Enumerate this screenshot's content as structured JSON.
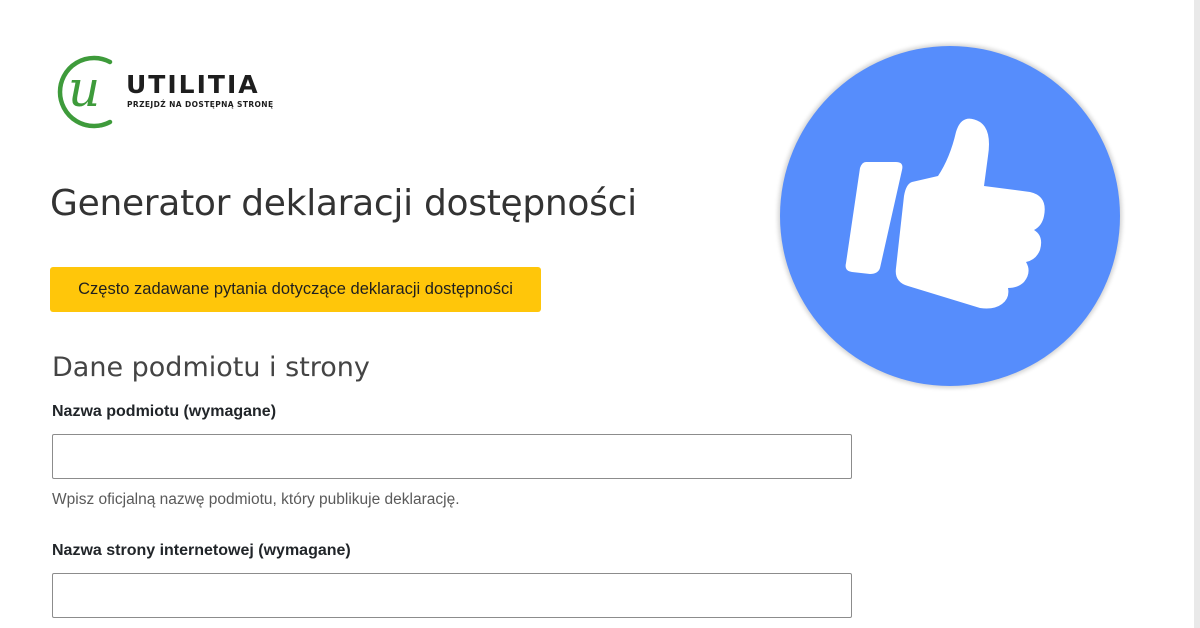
{
  "logo": {
    "letter": "u",
    "wordmark": "UTILITIA",
    "tagline": "PRZEJDŹ NA DOSTĘPNĄ STRONĘ",
    "color": "#3e9b3b"
  },
  "page": {
    "title": "Generator deklaracji dostępności",
    "faq_button": "Często zadawane pytania dotyczące deklaracji dostępności",
    "faq_button_color": "#ffc60a",
    "section_title": "Dane podmiotu i strony"
  },
  "fields": [
    {
      "label": "Nazwa podmiotu (wymagane)",
      "value": "",
      "help": "Wpisz oficjalną nazwę podmiotu, który publikuje deklarację."
    },
    {
      "label": "Nazwa strony internetowej (wymagane)",
      "value": ""
    }
  ],
  "badge": {
    "icon": "thumbs-up-icon",
    "color": "#568dfc"
  }
}
